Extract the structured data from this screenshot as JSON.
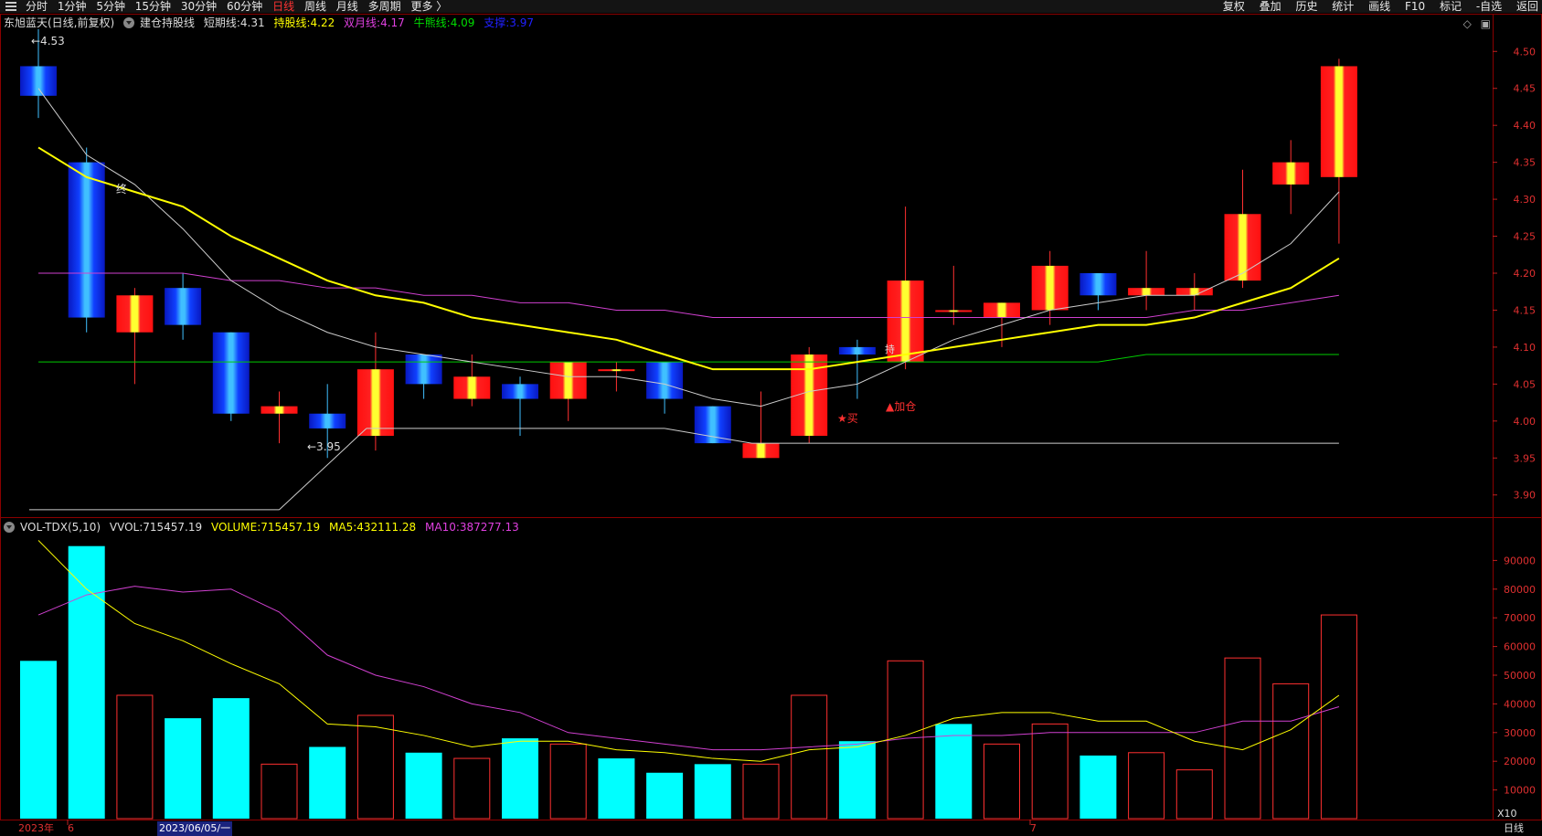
{
  "topbar": {
    "nav": [
      "分时",
      "1分钟",
      "5分钟",
      "15分钟",
      "30分钟",
      "60分钟",
      "日线",
      "周线",
      "月线",
      "多周期",
      "更多 〉"
    ],
    "active": "日线",
    "right": [
      "复权",
      "叠加",
      "历史",
      "统计",
      "画线",
      "F10",
      "标记",
      "-自选",
      "返回"
    ]
  },
  "legend1": {
    "stock": "东旭蓝天(日线,前复权)",
    "indicator": "建仓持股线",
    "short_label": "短期线:",
    "short_val": "4.31",
    "hold_label": "持股线:",
    "hold_val": "4.22",
    "double_label": "双月线:",
    "double_val": "4.17",
    "bull_label": "牛熊线:",
    "bull_val": "4.09",
    "support_label": "支撑:",
    "support_val": "3.97"
  },
  "legend2": {
    "name": "VOL-TDX(5,10)",
    "vvol_label": "VVOL:",
    "vvol_val": "715457.19",
    "volume_label": "VOLUME:",
    "volume_val": "715457.19",
    "ma5_label": "MA5:",
    "ma5_val": "432111.28",
    "ma10_label": "MA10:",
    "ma10_val": "387277.13"
  },
  "annotations": {
    "high": "4.53",
    "low": "3.95",
    "zhong": "终",
    "buy": "★买",
    "add": "▲加仓",
    "chi": "持"
  },
  "timeaxis": {
    "year": "2023年",
    "m6": "6",
    "selected": "2023/06/05/一",
    "m7": "7",
    "tab": "日线"
  },
  "vol_multiplier": "X10",
  "colors": {
    "up": "#ff2020",
    "down": "#1060ff",
    "cyan": "#00ffff",
    "bg": "#000000",
    "short": "#cccccc",
    "hold": "#ffff00",
    "double": "#d040d0",
    "bull": "#00cc00",
    "support": "#cccccc"
  },
  "chart_data": [
    {
      "type": "candlestick",
      "yticks": [
        3.9,
        3.95,
        4.0,
        4.05,
        4.1,
        4.15,
        4.2,
        4.25,
        4.3,
        4.35,
        4.4,
        4.45,
        4.5
      ],
      "ylim": [
        3.87,
        4.53
      ],
      "candles": [
        {
          "o": 4.48,
          "h": 4.53,
          "l": 4.41,
          "c": 4.44
        },
        {
          "o": 4.35,
          "h": 4.37,
          "l": 4.12,
          "c": 4.14
        },
        {
          "o": 4.12,
          "h": 4.18,
          "l": 4.05,
          "c": 4.17
        },
        {
          "o": 4.18,
          "h": 4.2,
          "l": 4.11,
          "c": 4.13
        },
        {
          "o": 4.12,
          "h": 4.12,
          "l": 4.0,
          "c": 4.01
        },
        {
          "o": 4.01,
          "h": 4.04,
          "l": 3.97,
          "c": 4.02
        },
        {
          "o": 4.01,
          "h": 4.05,
          "l": 3.95,
          "c": 3.99
        },
        {
          "o": 3.98,
          "h": 4.12,
          "l": 3.96,
          "c": 4.07
        },
        {
          "o": 4.09,
          "h": 4.09,
          "l": 4.03,
          "c": 4.05
        },
        {
          "o": 4.03,
          "h": 4.09,
          "l": 4.02,
          "c": 4.06
        },
        {
          "o": 4.05,
          "h": 4.06,
          "l": 3.98,
          "c": 4.03
        },
        {
          "o": 4.03,
          "h": 4.08,
          "l": 4.0,
          "c": 4.08
        },
        {
          "o": 4.07,
          "h": 4.08,
          "l": 4.04,
          "c": 4.07
        },
        {
          "o": 4.08,
          "h": 4.08,
          "l": 4.01,
          "c": 4.03
        },
        {
          "o": 4.02,
          "h": 4.02,
          "l": 3.97,
          "c": 3.97
        },
        {
          "o": 3.95,
          "h": 4.04,
          "l": 3.95,
          "c": 3.97
        },
        {
          "o": 3.98,
          "h": 4.1,
          "l": 3.97,
          "c": 4.09
        },
        {
          "o": 4.1,
          "h": 4.11,
          "l": 4.03,
          "c": 4.09
        },
        {
          "o": 4.08,
          "h": 4.29,
          "l": 4.07,
          "c": 4.19
        },
        {
          "o": 4.15,
          "h": 4.21,
          "l": 4.13,
          "c": 4.15
        },
        {
          "o": 4.14,
          "h": 4.16,
          "l": 4.1,
          "c": 4.16
        },
        {
          "o": 4.15,
          "h": 4.23,
          "l": 4.13,
          "c": 4.21
        },
        {
          "o": 4.2,
          "h": 4.2,
          "l": 4.15,
          "c": 4.17
        },
        {
          "o": 4.17,
          "h": 4.23,
          "l": 4.15,
          "c": 4.18
        },
        {
          "o": 4.17,
          "h": 4.2,
          "l": 4.15,
          "c": 4.18
        },
        {
          "o": 4.19,
          "h": 4.34,
          "l": 4.18,
          "c": 4.28
        },
        {
          "o": 4.32,
          "h": 4.38,
          "l": 4.28,
          "c": 4.35
        },
        {
          "o": 4.33,
          "h": 4.49,
          "l": 4.24,
          "c": 4.48
        }
      ],
      "lines": {
        "short": [
          4.45,
          4.36,
          4.32,
          4.26,
          4.19,
          4.15,
          4.12,
          4.1,
          4.09,
          4.08,
          4.07,
          4.06,
          4.06,
          4.05,
          4.03,
          4.02,
          4.04,
          4.05,
          4.08,
          4.11,
          4.13,
          4.15,
          4.16,
          4.17,
          4.17,
          4.2,
          4.24,
          4.31
        ],
        "hold": [
          4.37,
          4.33,
          4.31,
          4.29,
          4.25,
          4.22,
          4.19,
          4.17,
          4.16,
          4.14,
          4.13,
          4.12,
          4.11,
          4.09,
          4.07,
          4.07,
          4.07,
          4.08,
          4.09,
          4.1,
          4.11,
          4.12,
          4.13,
          4.13,
          4.14,
          4.16,
          4.18,
          4.22
        ],
        "double": [
          4.2,
          4.2,
          4.2,
          4.2,
          4.19,
          4.19,
          4.18,
          4.18,
          4.17,
          4.17,
          4.16,
          4.16,
          4.15,
          4.15,
          4.14,
          4.14,
          4.14,
          4.14,
          4.14,
          4.14,
          4.14,
          4.14,
          4.14,
          4.14,
          4.15,
          4.15,
          4.16,
          4.17
        ],
        "bull": [
          4.08,
          4.08,
          4.08,
          4.08,
          4.08,
          4.08,
          4.08,
          4.08,
          4.08,
          4.08,
          4.08,
          4.08,
          4.08,
          4.08,
          4.08,
          4.08,
          4.08,
          4.08,
          4.08,
          4.08,
          4.08,
          4.08,
          4.08,
          4.09,
          4.09,
          4.09,
          4.09,
          4.09
        ],
        "support_segments": [
          {
            "from": 0,
            "to": 5,
            "v": 3.88
          },
          {
            "from": 7,
            "to": 13,
            "v": 3.99
          },
          {
            "from": 15,
            "to": 27,
            "v": 3.97
          }
        ]
      }
    },
    {
      "type": "bar",
      "name": "VOL-TDX(5,10)",
      "yticks": [
        10000,
        20000,
        30000,
        40000,
        50000,
        60000,
        70000,
        80000,
        90000
      ],
      "ylim": [
        0,
        100000
      ],
      "values": [
        55000,
        95000,
        43000,
        35000,
        42000,
        19000,
        25000,
        36000,
        23000,
        21000,
        28000,
        26000,
        21000,
        16000,
        19000,
        19000,
        43000,
        27000,
        55000,
        33000,
        26000,
        33000,
        22000,
        23000,
        17000,
        56000,
        47000,
        71000
      ],
      "up": [
        false,
        false,
        true,
        false,
        false,
        true,
        false,
        true,
        false,
        true,
        false,
        true,
        false,
        false,
        false,
        true,
        true,
        false,
        true,
        false,
        true,
        true,
        false,
        true,
        true,
        true,
        true,
        true
      ],
      "ma5": [
        97000,
        80000,
        68000,
        62000,
        54000,
        47000,
        33000,
        32000,
        29000,
        25000,
        27000,
        27000,
        24000,
        23000,
        21000,
        20000,
        24000,
        25000,
        29000,
        35000,
        37000,
        37000,
        34000,
        34000,
        27000,
        24000,
        31000,
        43000
      ],
      "ma10": [
        71000,
        78000,
        81000,
        79000,
        80000,
        72000,
        57000,
        50000,
        46000,
        40000,
        37000,
        30000,
        28000,
        26000,
        24000,
        24000,
        25000,
        26000,
        28000,
        29000,
        29000,
        30000,
        30000,
        30000,
        30000,
        34000,
        34000,
        39000
      ]
    }
  ]
}
